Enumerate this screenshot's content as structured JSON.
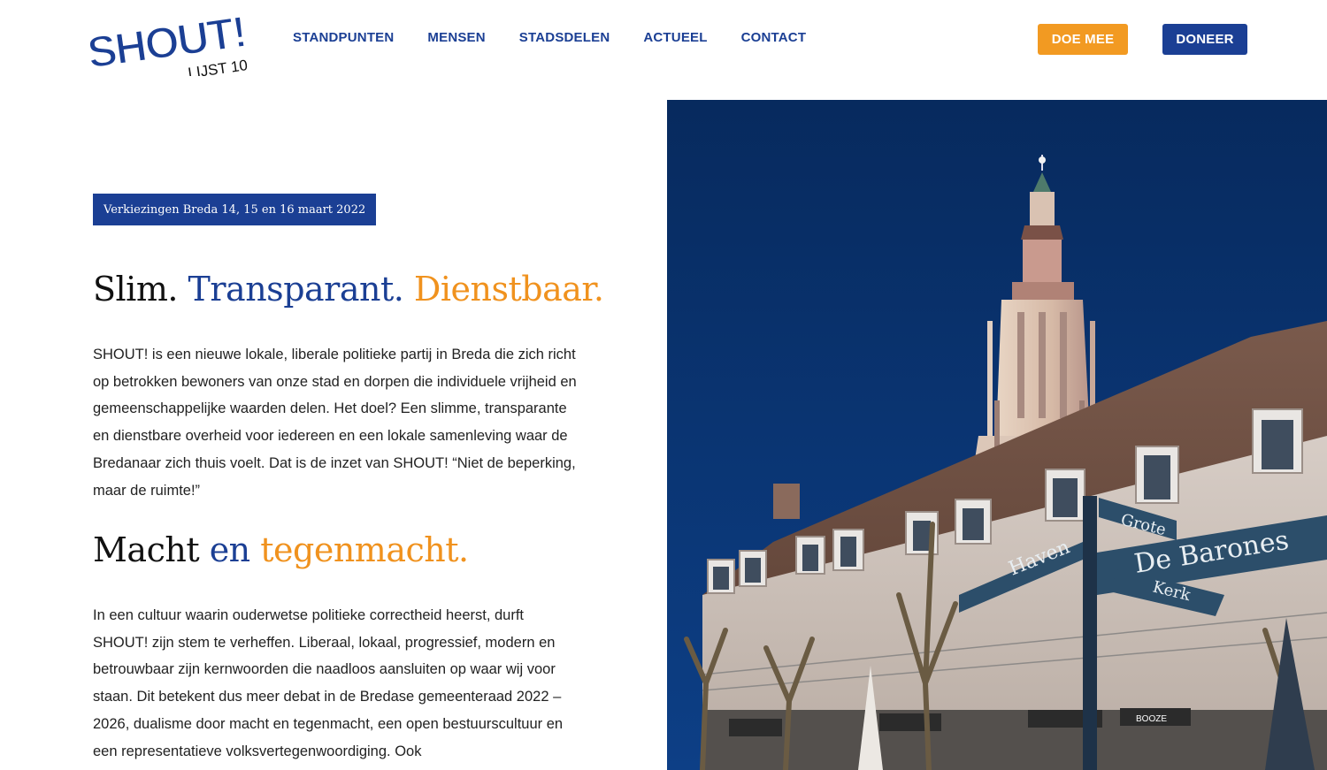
{
  "logo": {
    "brand": "SHOUT!",
    "sub": "LIJST 10"
  },
  "nav": {
    "items": [
      "STANDPUNTEN",
      "MENSEN",
      "STADSDELEN",
      "ACTUEEL",
      "CONTACT"
    ]
  },
  "buttons": {
    "doe_mee": "DOE MEE",
    "doneer": "DONEER"
  },
  "colors": {
    "brand_blue": "#1b3f94",
    "brand_orange": "#f29a22",
    "sky": "#0a2f66"
  },
  "badge": "Verkiezingen Breda 14, 15 en 16 maart 2022",
  "heading1": {
    "part1": "Slim.",
    "part2": "Transparant.",
    "part3": "Dienstbaar."
  },
  "paragraph1": "SHOUT! is een nieuwe lokale, liberale politieke partij in Breda die zich richt op betrokken bewoners van onze stad en dorpen die individuele vrijheid en gemeenschappelijke waarden delen. Het doel? Een slimme, transparante en dienstbare overheid voor iedereen en een lokale samenleving waar de Bredanaar zich thuis voelt. Dat is de inzet van SHOUT! “Niet de beperking, maar de ruimte!”",
  "heading2": {
    "part1": "Macht",
    "part2": "en",
    "part3": "tegenmacht."
  },
  "paragraph2": "In een cultuur waarin ouderwetse politieke correctheid heerst, durft SHOUT! zijn stem te verheffen. Liberaal, lokaal, progressief, modern en betrouwbaar zijn kernwoorden die naadloos aansluiten op waar wij voor staan. Dit betekent dus meer debat in de Bredase gemeenteraad 2022 – 2026, dualisme door macht en tegenmacht, een open bestuurscultuur en een representatieve volksvertegenwoordiging. Ook",
  "hero": {
    "signs": {
      "haven": "Haven",
      "barones": "De Barones",
      "grote": "Grote",
      "kerk": "Kerk"
    },
    "shop": "BOOZE"
  }
}
